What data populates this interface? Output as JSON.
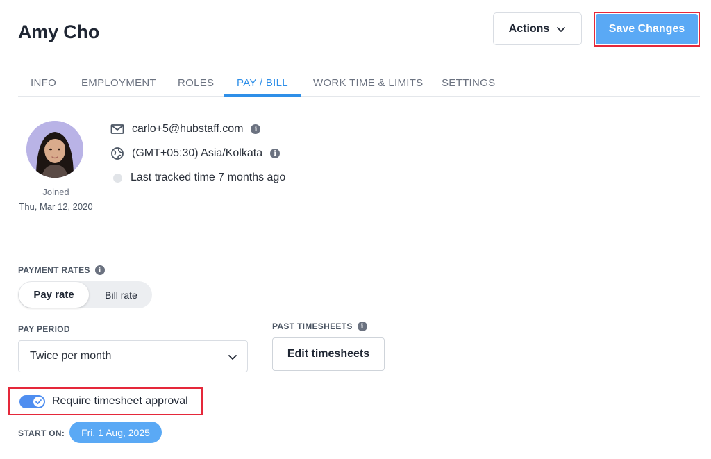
{
  "header": {
    "title": "Amy Cho",
    "actions_label": "Actions",
    "save_label": "Save Changes"
  },
  "tabs": [
    {
      "label": "INFO"
    },
    {
      "label": "EMPLOYMENT"
    },
    {
      "label": "ROLES"
    },
    {
      "label": "PAY / BILL",
      "active": true
    },
    {
      "label": "WORK TIME & LIMITS"
    },
    {
      "label": "SETTINGS"
    }
  ],
  "profile": {
    "joined_label": "Joined",
    "joined_date": "Thu, Mar 12, 2020",
    "email": "carlo+5@hubstaff.com",
    "timezone": "(GMT+05:30) Asia/Kolkata",
    "last_tracked": "Last tracked time 7 months ago"
  },
  "payment_rates": {
    "label": "PAYMENT RATES",
    "options": [
      "Pay rate",
      "Bill rate"
    ],
    "selected": "Pay rate"
  },
  "pay_period": {
    "label": "PAY PERIOD",
    "value": "Twice per month"
  },
  "past_timesheets": {
    "label": "PAST TIMESHEETS",
    "button_label": "Edit timesheets"
  },
  "approval": {
    "label": "Require timesheet approval",
    "enabled": true
  },
  "start_on": {
    "label": "START ON:",
    "date": "Fri, 1 Aug, 2025"
  },
  "colors": {
    "accent": "#2f8fe8",
    "save_button": "#5aa9f5",
    "toggle_on": "#4f8ef0",
    "highlight_border": "#e5283a"
  }
}
